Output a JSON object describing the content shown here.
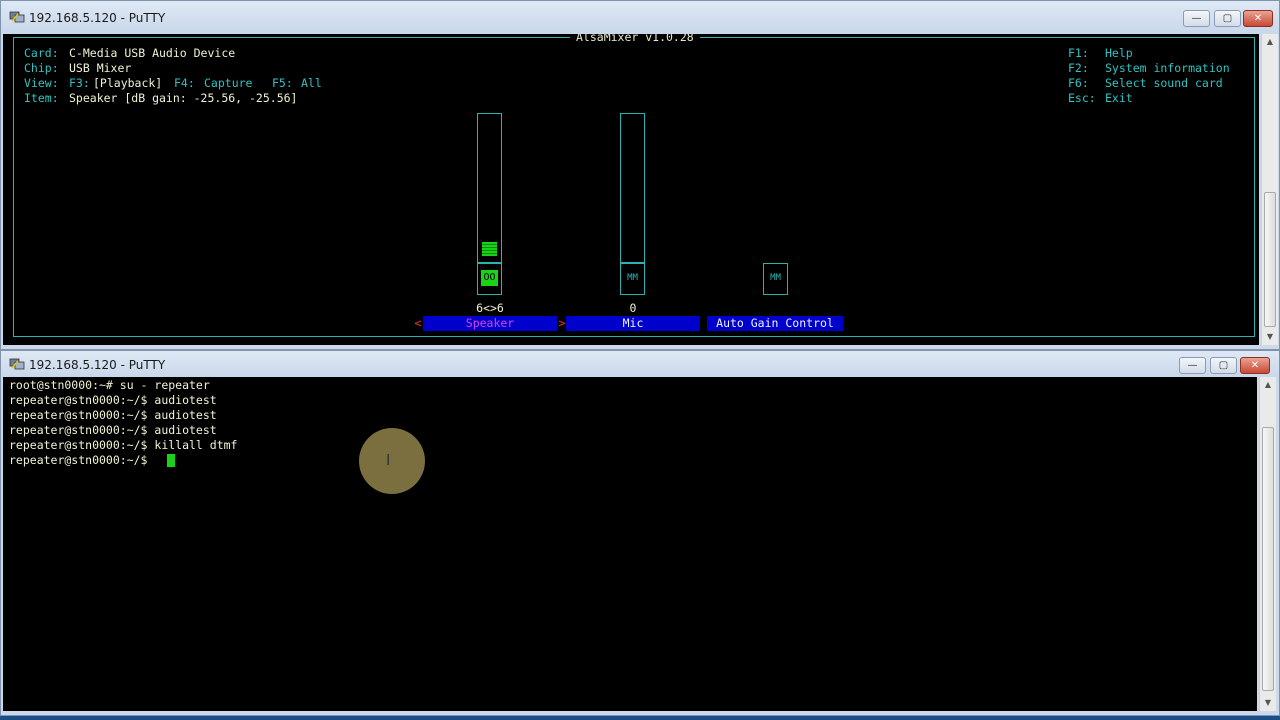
{
  "top_window": {
    "title": "192.168.5.120 - PuTTY",
    "controls": {
      "minimize": "—",
      "maximize": "▢",
      "close": "✕"
    },
    "mixer": {
      "app_title": "AlsaMixer v1.0.28",
      "card_label": "Card:",
      "card_value": "C-Media USB Audio Device",
      "chip_label": "Chip:",
      "chip_value": "USB Mixer",
      "view_label": "View:",
      "view_f3": "F3:",
      "view_playback": "[Playback]",
      "view_f4": "F4:",
      "view_capture": "Capture",
      "view_f5": "F5:",
      "view_all": "All",
      "item_label": "Item:",
      "item_value": "Speaker [dB gain: -25.56, -25.56]",
      "help": [
        {
          "key": "F1:",
          "desc": "Help"
        },
        {
          "key": "F2:",
          "desc": "System information"
        },
        {
          "key": "F6:",
          "desc": "Select sound card"
        },
        {
          "key": "Esc:",
          "desc": "Exit"
        }
      ],
      "controls": [
        {
          "name": "Speaker",
          "switch": "OO",
          "value": "6<>6",
          "level": 0.2,
          "prev_arrow": "<",
          "next_arrow": ">",
          "selected": true
        },
        {
          "name": "Mic",
          "switch": "MM",
          "value": "0",
          "level": 0
        },
        {
          "name": "Auto Gain Control",
          "switch": "MM"
        }
      ]
    }
  },
  "bottom_window": {
    "title": "192.168.5.120 - PuTTY",
    "controls": {
      "minimize": "—",
      "maximize": "▢",
      "close": "✕"
    },
    "lines": [
      "root@stn0000:~# su - repeater",
      "repeater@stn0000:~/$ audiotest",
      "repeater@stn0000:~/$ audiotest",
      "repeater@stn0000:~/$ audiotest",
      "repeater@stn0000:~/$ killall dtmf",
      "repeater@stn0000:~/$ "
    ]
  },
  "colors": {
    "terminal_bg": "#000000",
    "mixer_frame": "#2bb3b3",
    "selected_bar": "#0000cc",
    "prompt_cursor": "#19d319",
    "speaker_label": "#e040e0"
  }
}
